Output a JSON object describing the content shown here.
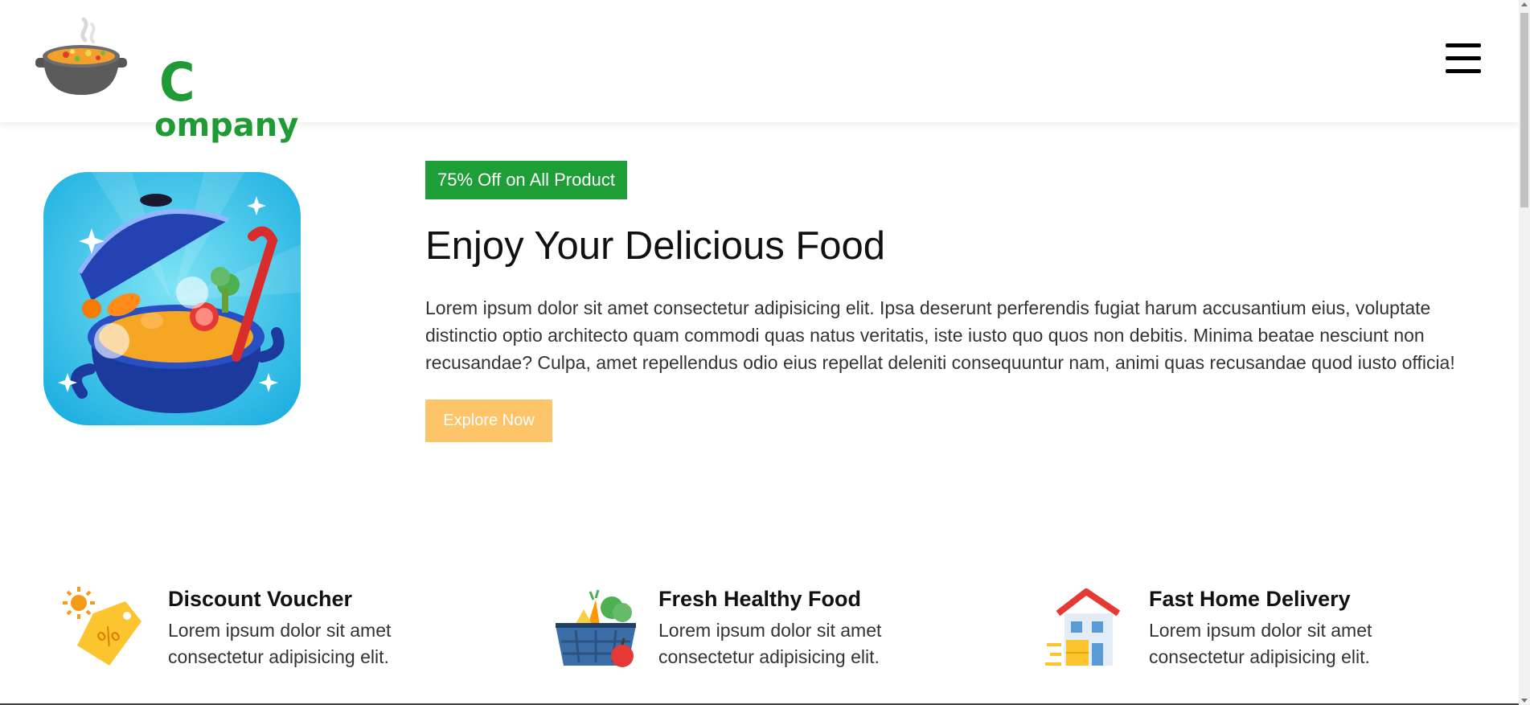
{
  "header": {
    "logo": {
      "text_big": "C",
      "text_rest": "ompany",
      "icon": "soup-pot-icon",
      "color": "#1f9a34"
    },
    "menu_icon": "hamburger-menu-icon"
  },
  "hero": {
    "image_icon": "cooking-pot-icon",
    "badge": "75% Off on All Product",
    "title": "Enjoy Your Delicious Food",
    "description": "Lorem ipsum dolor sit amet consectetur adipisicing elit. Ipsa deserunt perferendis fugiat harum accusantium eius, voluptate distinctio optio architecto quam commodi quas natus veritatis, iste iusto quo quos non debitis. Minima beatae nesciunt non recusandae? Culpa, amet repellendus odio eius repellat deleniti consequuntur nam, animi quas recusandae quod iusto officia!",
    "button_label": "Explore Now",
    "badge_color": "#1d9e37",
    "button_color": "#fdc46a"
  },
  "features": [
    {
      "icon": "discount-tag-icon",
      "title": "Discount Voucher",
      "description": "Lorem ipsum dolor sit amet consectetur adipisicing elit."
    },
    {
      "icon": "grocery-basket-icon",
      "title": "Fresh Healthy Food",
      "description": "Lorem ipsum dolor sit amet consectetur adipisicing elit."
    },
    {
      "icon": "delivery-house-icon",
      "title": "Fast Home Delivery",
      "description": "Lorem ipsum dolor sit amet consectetur adipisicing elit."
    }
  ]
}
